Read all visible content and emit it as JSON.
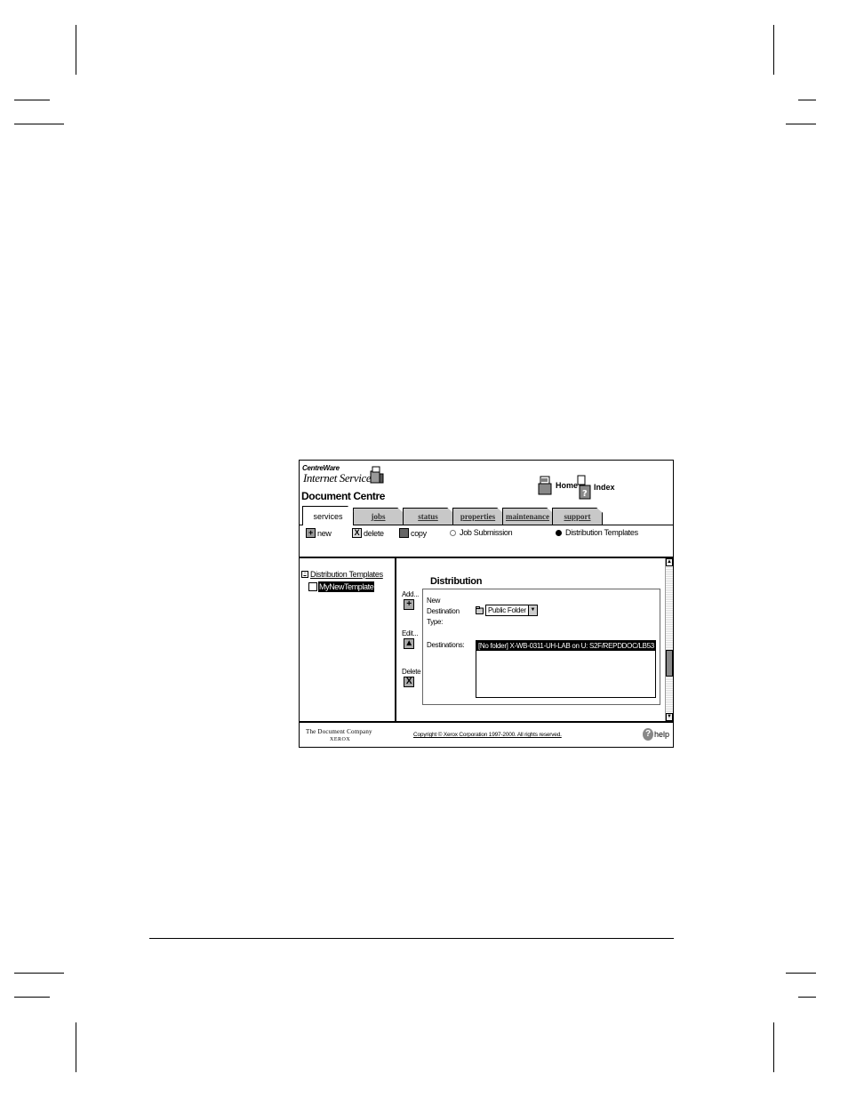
{
  "app": {
    "brand_line1": "CentreWare",
    "brand_line2": "Internet Services",
    "product": "Document Centre"
  },
  "header_links": [
    {
      "label": "Home",
      "icon": "home-printer-icon"
    },
    {
      "label": "Index",
      "icon": "index-icon"
    }
  ],
  "tabs": [
    {
      "label": "services",
      "active": true
    },
    {
      "label": "jobs",
      "active": false
    },
    {
      "label": "status",
      "active": false
    },
    {
      "label": "properties",
      "active": false
    },
    {
      "label": "maintenance",
      "active": false
    },
    {
      "label": "support",
      "active": false
    }
  ],
  "toolbar": {
    "new_label": "new",
    "delete_label": "delete",
    "copy_label": "copy",
    "radio_job_submission": "Job Submission",
    "radio_distribution_templates": "Distribution Templates",
    "selected_radio": "Distribution Templates"
  },
  "tree": {
    "root": "Distribution Templates",
    "children": [
      "MyNewTemplate"
    ]
  },
  "panel": {
    "title": "Distribution",
    "add_label": "Add...",
    "edit_label": "Edit...",
    "delete_label": "Delete",
    "new_destination_label_1": "New",
    "new_destination_label_2": "Destination",
    "new_destination_label_3": "Type:",
    "destination_type_value": "Public Folder",
    "destinations_label": "Destinations:",
    "destinations": [
      "[No folder] X-WB-0311-UH-LAB on U: S2F/REPDDOC/LB53"
    ]
  },
  "footer": {
    "company_line": "The Document Company",
    "company_brand": "XEROX",
    "copyright": "Copyright © Xerox Corporation 1997-2000. All rights reserved.",
    "help_label": "help"
  }
}
